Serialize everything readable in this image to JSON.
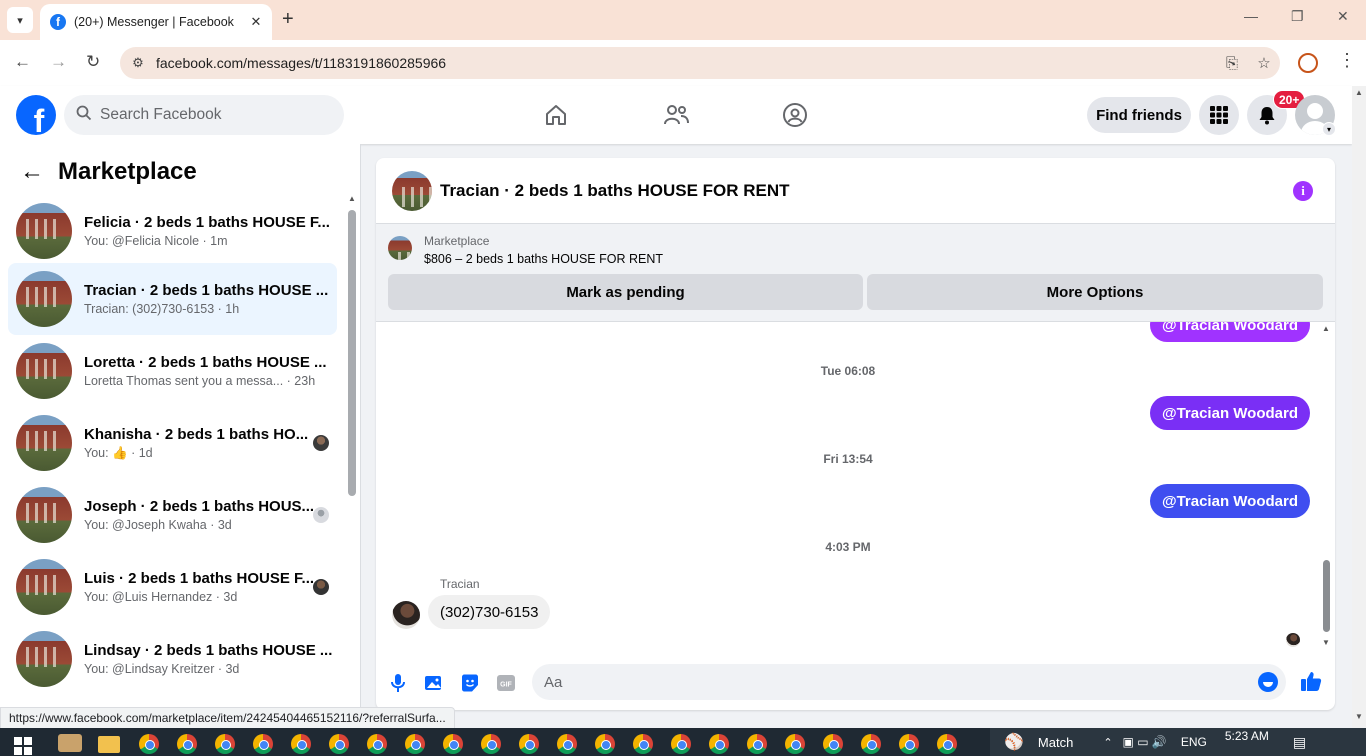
{
  "browser": {
    "tab_title": "(20+) Messenger | Facebook",
    "url": "facebook.com/messages/t/1183191860285966",
    "status_url": "https://www.facebook.com/marketplace/item/24245404465152116/?referralSurfa..."
  },
  "header": {
    "search_placeholder": "Search Facebook",
    "find_friends_label": "Find friends",
    "notification_badge": "20+"
  },
  "sidebar": {
    "title": "Marketplace",
    "conversations": [
      {
        "name": "Felicia · 2 beds 1 baths HOUSE F...",
        "preview": "You: @Felicia Nicole · 1m"
      },
      {
        "name": "Tracian · 2 beds 1 baths HOUSE ...",
        "preview": "Tracian: (302)730-6153 · 1h"
      },
      {
        "name": "Loretta · 2 beds 1 baths HOUSE ...",
        "preview": "Loretta Thomas sent you a messa...  · 23h"
      },
      {
        "name": "Khanisha · 2 beds 1 baths HO...",
        "preview": "You: 👍 · 1d"
      },
      {
        "name": "Joseph · 2 beds 1 baths HOUS...",
        "preview": "You: @Joseph Kwaha · 3d"
      },
      {
        "name": "Luis · 2 beds 1 baths HOUSE F...",
        "preview": "You: @Luis Hernandez · 3d"
      },
      {
        "name": "Lindsay · 2 beds 1 baths HOUSE ...",
        "preview": "You: @Lindsay Kreitzer · 3d"
      }
    ]
  },
  "chat": {
    "title": "Tracian · 2 beds 1 baths HOUSE FOR RENT",
    "marketplace_label": "Marketplace",
    "listing": "$806 – 2 beds 1 baths HOUSE FOR RENT",
    "mark_pending_label": "Mark as pending",
    "more_options_label": "More Options",
    "messages": {
      "out_top": "@Tracian Woodard",
      "ts1": "Tue 06:08",
      "out1": "@Tracian Woodard",
      "ts2": "Fri 13:54",
      "out2": "@Tracian Woodard",
      "ts3": "4:03 PM",
      "sender": "Tracian",
      "in1": "(302)730-6153"
    },
    "composer_placeholder": "Aa"
  },
  "taskbar": {
    "weather": "Match",
    "lang": "ENG",
    "time": "5:23 AM"
  },
  "colors": {
    "fb_blue": "#0866ff",
    "bubble_purple": "#a033ff",
    "bubble_mid": "#7a2ff5",
    "bubble_blue": "#3f4ef0",
    "badge_red": "#e41e3f"
  }
}
